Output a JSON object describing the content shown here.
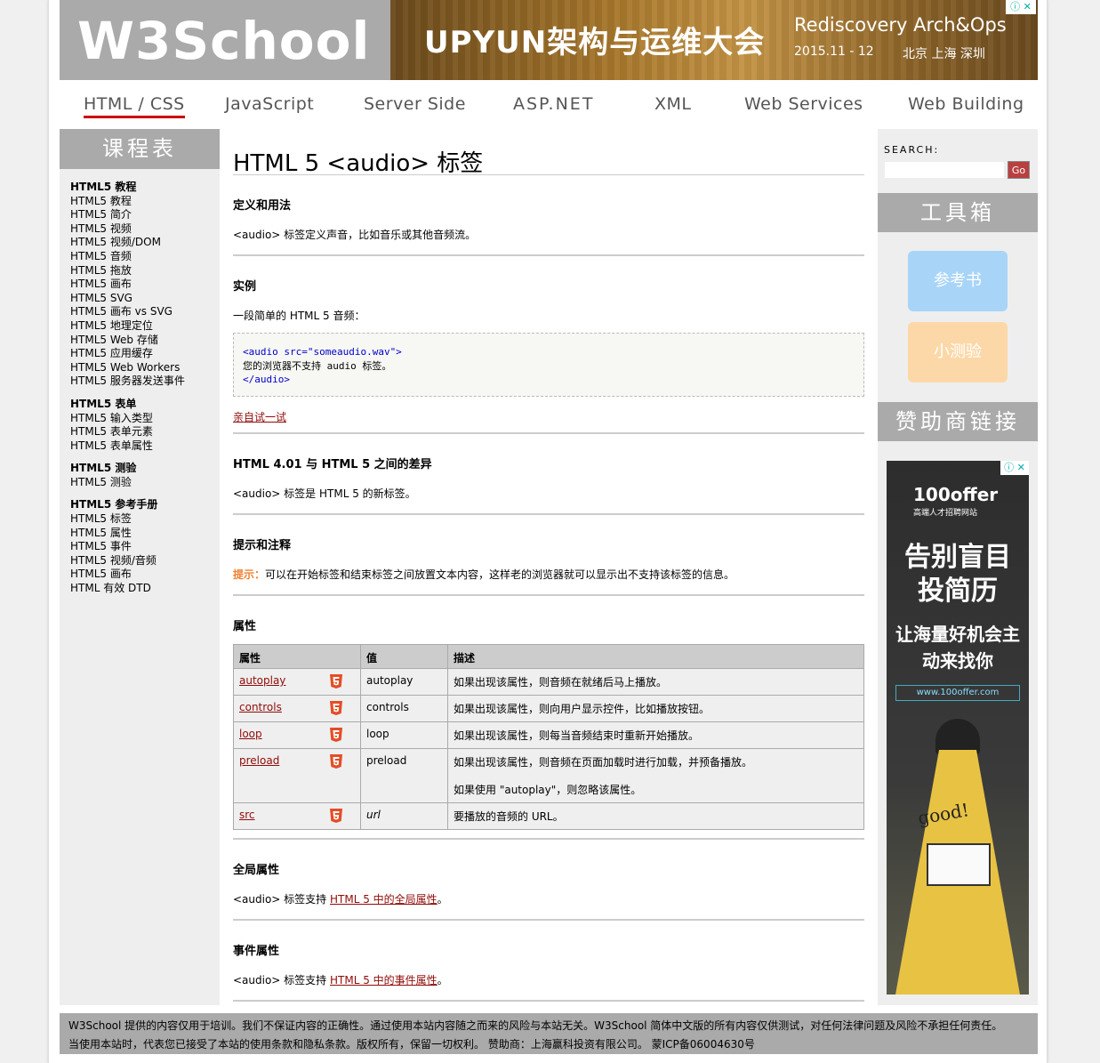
{
  "header": {
    "logo": "W3School",
    "banner": {
      "title": "UPYUN架构与运维大会",
      "subtitle": "Rediscovery Arch&Ops",
      "date": "2015.11 - 12",
      "cities": "北京 上海 深圳",
      "ad_icons": "ⓘ ✕"
    }
  },
  "nav": [
    "HTML / CSS",
    "JavaScript",
    "Server Side",
    "ASP.NET",
    "XML",
    "Web Services",
    "Web Building"
  ],
  "left_nav": {
    "title": "课程表",
    "groups": [
      {
        "title": "HTML5 教程",
        "items": [
          "HTML5 教程",
          "HTML5 简介",
          "HTML5 视频",
          "HTML5 视频/DOM",
          "HTML5 音频",
          "HTML5 拖放",
          "HTML5 画布",
          "HTML5 SVG",
          "HTML5 画布 vs SVG",
          "HTML5 地理定位",
          "HTML5 Web 存储",
          "HTML5 应用缓存",
          "HTML5 Web Workers",
          "HTML5 服务器发送事件"
        ]
      },
      {
        "title": "HTML5 表单",
        "items": [
          "HTML5 输入类型",
          "HTML5 表单元素",
          "HTML5 表单属性"
        ]
      },
      {
        "title": "HTML5 测验",
        "items": [
          "HTML5 测验"
        ]
      },
      {
        "title": "HTML5 参考手册",
        "items": [
          "HTML5 标签",
          "HTML5 属性",
          "HTML5 事件",
          "HTML5 视频/音频",
          "HTML5 画布",
          "HTML 有效 DTD"
        ]
      }
    ]
  },
  "main": {
    "title": "HTML 5 <audio> 标签",
    "def_heading": "定义和用法",
    "def_text": "<audio> 标签定义声音，比如音乐或其他音频流。",
    "example_heading": "实例",
    "example_text": "一段简单的 HTML 5 音频：",
    "code_line1": "<audio src=\"someaudio.wav\">",
    "code_line2": "您的浏览器不支持 audio 标签。",
    "code_line3": "</audio>",
    "try_link": "亲自试一试",
    "diff_heading": "HTML 4.01 与 HTML 5 之间的差异",
    "diff_text": "<audio> 标签是 HTML 5 的新标签。",
    "tips_heading": "提示和注释",
    "tip_label": "提示：",
    "tip_text": "可以在开始标签和结束标签之间放置文本内容，这样老的浏览器就可以显示出不支持该标签的信息。",
    "attr_heading": "属性",
    "table": {
      "headers": [
        "属性",
        "值",
        "描述"
      ],
      "rows": [
        {
          "attr": "autoplay",
          "value": "autoplay",
          "desc": "如果出现该属性，则音频在就绪后马上播放。",
          "desc2": ""
        },
        {
          "attr": "controls",
          "value": "controls",
          "desc": "如果出现该属性，则向用户显示控件，比如播放按钮。",
          "desc2": ""
        },
        {
          "attr": "loop",
          "value": "loop",
          "desc": "如果出现该属性，则每当音频结束时重新开始播放。",
          "desc2": ""
        },
        {
          "attr": "preload",
          "value": "preload",
          "desc": "如果出现该属性，则音频在页面加载时进行加载，并预备播放。",
          "desc2": "如果使用 \"autoplay\"，则忽略该属性。"
        },
        {
          "attr": "src",
          "value": "url",
          "desc": "要播放的音频的 URL。",
          "desc2": ""
        }
      ]
    },
    "global_heading": "全局属性",
    "global_prefix": "<audio> 标签支持 ",
    "global_link": "HTML 5 中的全局属性",
    "global_suffix": "。",
    "event_heading": "事件属性",
    "event_prefix": "<audio> 标签支持 ",
    "event_link": "HTML 5 中的事件属性",
    "event_suffix": "。"
  },
  "sidebar": {
    "search_label": "SEARCH:",
    "search_value": "",
    "go_label": "Go",
    "toolbox_title": "工具箱",
    "reference_btn": "参考书",
    "quiz_btn": "小测验",
    "sponsor_title": "赞助商链接",
    "ad": {
      "brand": "100offer",
      "brand_sub": "高端人才招聘网站",
      "line1": "告别盲目投简历",
      "line2": "让海量好机会主动来找你",
      "url": "www.100offer.com",
      "good": "good!",
      "ad_icons": "ⓘ ✕"
    }
  },
  "footer": {
    "line1": "W3School 提供的内容仅用于培训。我们不保证内容的正确性。通过使用本站内容随之而来的风险与本站无关。W3School 简体中文版的所有内容仅供测试，对任何法律问题及风险不承担任何责任。",
    "line2": "当使用本站时，代表您已接受了本站的使用条款和隐私条款。版权所有，保留一切权利。 赞助商：上海赢科投资有限公司。 蒙ICP备06004630号"
  },
  "colors": {
    "accent_red": "#900b09",
    "nav_gray": "#aaaaaa",
    "tip_orange": "#f08030",
    "ref_btn": "#a8d4f8",
    "quiz_btn": "#fcd8a8"
  }
}
